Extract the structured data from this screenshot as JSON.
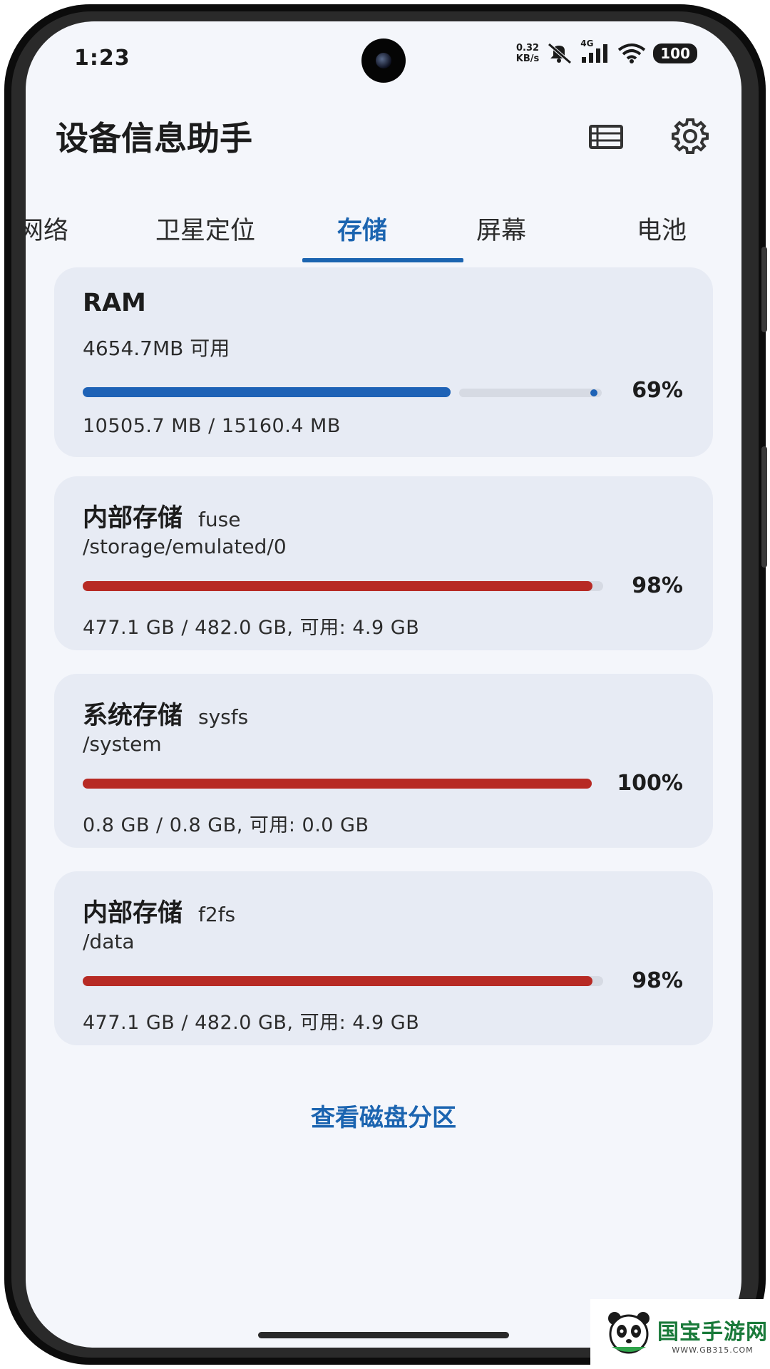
{
  "status_bar": {
    "time": "1:23",
    "net_speed_value": "0.32",
    "net_speed_unit": "KB/s",
    "network_type": "4G",
    "battery": "100"
  },
  "app_bar": {
    "title": "设备信息助手",
    "list_icon": "list-icon",
    "settings_icon": "gear-icon"
  },
  "tabs": [
    {
      "label": "网络"
    },
    {
      "label": "卫星定位"
    },
    {
      "label": "存储",
      "active": true
    },
    {
      "label": "屏幕"
    },
    {
      "label": "电池"
    }
  ],
  "ram": {
    "title": "RAM",
    "available": "4654.7MB 可用",
    "percent": "69%",
    "usage": "10505.7 MB / 15160.4 MB",
    "fill_fraction": 0.69,
    "bar_color": "#1e62b6"
  },
  "storages": [
    {
      "title": "内部存储",
      "fs": "fuse",
      "path": "/storage/emulated/0",
      "percent": "98%",
      "fill_fraction": 0.98,
      "usage": "477.1 GB / 482.0 GB, 可用: 4.9 GB",
      "bar_color": "#b72a24"
    },
    {
      "title": "系统存储",
      "fs": "sysfs",
      "path": "/system",
      "percent": "100%",
      "fill_fraction": 1.0,
      "usage": "0.8 GB / 0.8 GB, 可用: 0.0 GB",
      "bar_color": "#b72a24"
    },
    {
      "title": "内部存储",
      "fs": "f2fs",
      "path": "/data",
      "percent": "98%",
      "fill_fraction": 0.98,
      "usage": "477.1 GB / 482.0 GB, 可用: 4.9 GB",
      "bar_color": "#b72a24"
    }
  ],
  "disk_partition_link": "查看磁盘分区",
  "watermark": {
    "name": "国宝手游网",
    "url": "WWW.GB315.COM"
  },
  "colors": {
    "accent": "#1b64b0",
    "danger": "#b72a24",
    "card_bg": "#e7ebf4",
    "screen_bg": "#f4f6fb"
  }
}
